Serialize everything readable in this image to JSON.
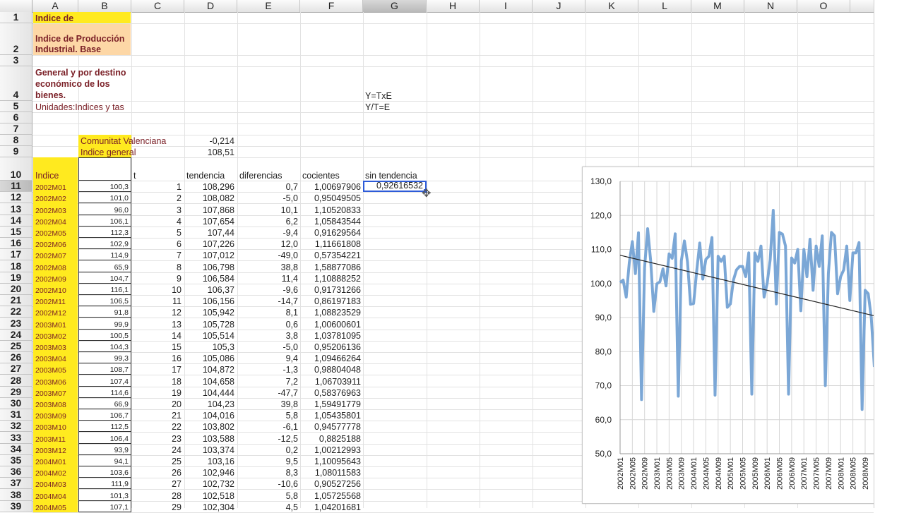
{
  "columns": [
    "A",
    "B",
    "C",
    "D",
    "E",
    "F",
    "G",
    "H",
    "I",
    "J",
    "K",
    "L",
    "M",
    "N",
    "O"
  ],
  "selected_column": "G",
  "selected_row": "11",
  "rows": [
    "1",
    "2",
    "3",
    "4",
    "5",
    "6",
    "7",
    "8",
    "9",
    "10",
    "11",
    "12",
    "13",
    "14",
    "15",
    "16",
    "17",
    "18",
    "19",
    "20",
    "21",
    "22",
    "23",
    "24",
    "25",
    "26",
    "27",
    "28",
    "29",
    "30",
    "31",
    "32",
    "33",
    "34",
    "35",
    "36",
    "37",
    "38",
    "39"
  ],
  "header_cells": {
    "a1": "Indice de",
    "a2": "Indice de Producción Industrial. Base",
    "a4": "General y por destino económico de los bienes.",
    "a5": "Unidades:Indices y tas",
    "b8": "Comunitat Valenciana",
    "d8": "-0,214",
    "b9": "Indice general",
    "d9": "108,51",
    "g4": "Y=TxE",
    "g5": "Y/T=E"
  },
  "table_headers": {
    "a": "Indice",
    "c": "t",
    "d": "tendencia",
    "e": "diferencias",
    "f": "cocientes",
    "g": "sin tendencia"
  },
  "data_rows": [
    {
      "a": "2002M01",
      "b": "100,3",
      "c": "1",
      "d": "108,296",
      "e": "0,7",
      "f": "1,00697906",
      "g": "0,92616532"
    },
    {
      "a": "2002M02",
      "b": "101,0",
      "c": "2",
      "d": "108,082",
      "e": "-5,0",
      "f": "0,95049505",
      "g": ""
    },
    {
      "a": "2002M03",
      "b": "96,0",
      "c": "3",
      "d": "107,868",
      "e": "10,1",
      "f": "1,10520833",
      "g": ""
    },
    {
      "a": "2002M04",
      "b": "106,1",
      "c": "4",
      "d": "107,654",
      "e": "6,2",
      "f": "1,05843544",
      "g": ""
    },
    {
      "a": "2002M05",
      "b": "112,3",
      "c": "5",
      "d": "107,44",
      "e": "-9,4",
      "f": "0,91629564",
      "g": ""
    },
    {
      "a": "2002M06",
      "b": "102,9",
      "c": "6",
      "d": "107,226",
      "e": "12,0",
      "f": "1,11661808",
      "g": ""
    },
    {
      "a": "2002M07",
      "b": "114,9",
      "c": "7",
      "d": "107,012",
      "e": "-49,0",
      "f": "0,57354221",
      "g": ""
    },
    {
      "a": "2002M08",
      "b": "65,9",
      "c": "8",
      "d": "106,798",
      "e": "38,8",
      "f": "1,58877086",
      "g": ""
    },
    {
      "a": "2002M09",
      "b": "104,7",
      "c": "9",
      "d": "106,584",
      "e": "11,4",
      "f": "1,10888252",
      "g": ""
    },
    {
      "a": "2002M10",
      "b": "116,1",
      "c": "10",
      "d": "106,37",
      "e": "-9,6",
      "f": "0,91731266",
      "g": ""
    },
    {
      "a": "2002M11",
      "b": "106,5",
      "c": "11",
      "d": "106,156",
      "e": "-14,7",
      "f": "0,86197183",
      "g": ""
    },
    {
      "a": "2002M12",
      "b": "91,8",
      "c": "12",
      "d": "105,942",
      "e": "8,1",
      "f": "1,08823529",
      "g": ""
    },
    {
      "a": "2003M01",
      "b": "99,9",
      "c": "13",
      "d": "105,728",
      "e": "0,6",
      "f": "1,00600601",
      "g": ""
    },
    {
      "a": "2003M02",
      "b": "100,5",
      "c": "14",
      "d": "105,514",
      "e": "3,8",
      "f": "1,03781095",
      "g": ""
    },
    {
      "a": "2003M03",
      "b": "104,3",
      "c": "15",
      "d": "105,3",
      "e": "-5,0",
      "f": "0,95206136",
      "g": ""
    },
    {
      "a": "2003M04",
      "b": "99,3",
      "c": "16",
      "d": "105,086",
      "e": "9,4",
      "f": "1,09466264",
      "g": ""
    },
    {
      "a": "2003M05",
      "b": "108,7",
      "c": "17",
      "d": "104,872",
      "e": "-1,3",
      "f": "0,98804048",
      "g": ""
    },
    {
      "a": "2003M06",
      "b": "107,4",
      "c": "18",
      "d": "104,658",
      "e": "7,2",
      "f": "1,06703911",
      "g": ""
    },
    {
      "a": "2003M07",
      "b": "114,6",
      "c": "19",
      "d": "104,444",
      "e": "-47,7",
      "f": "0,58376963",
      "g": ""
    },
    {
      "a": "2003M08",
      "b": "66,9",
      "c": "20",
      "d": "104,23",
      "e": "39,8",
      "f": "1,59491779",
      "g": ""
    },
    {
      "a": "2003M09",
      "b": "106,7",
      "c": "21",
      "d": "104,016",
      "e": "5,8",
      "f": "1,05435801",
      "g": ""
    },
    {
      "a": "2003M10",
      "b": "112,5",
      "c": "22",
      "d": "103,802",
      "e": "-6,1",
      "f": "0,94577778",
      "g": ""
    },
    {
      "a": "2003M11",
      "b": "106,4",
      "c": "23",
      "d": "103,588",
      "e": "-12,5",
      "f": "0,8825188",
      "g": ""
    },
    {
      "a": "2003M12",
      "b": "93,9",
      "c": "24",
      "d": "103,374",
      "e": "0,2",
      "f": "1,00212993",
      "g": ""
    },
    {
      "a": "2004M01",
      "b": "94,1",
      "c": "25",
      "d": "103,16",
      "e": "9,5",
      "f": "1,10095643",
      "g": ""
    },
    {
      "a": "2004M02",
      "b": "103,6",
      "c": "26",
      "d": "102,946",
      "e": "8,3",
      "f": "1,08011583",
      "g": ""
    },
    {
      "a": "2004M03",
      "b": "111,9",
      "c": "27",
      "d": "102,732",
      "e": "-10,6",
      "f": "0,90527256",
      "g": ""
    },
    {
      "a": "2004M04",
      "b": "101,3",
      "c": "28",
      "d": "102,518",
      "e": "5,8",
      "f": "1,05725568",
      "g": ""
    },
    {
      "a": "2004M05",
      "b": "107,1",
      "c": "29",
      "d": "102,304",
      "e": "4,5",
      "f": "1,04201681",
      "g": ""
    }
  ],
  "chart_data": {
    "type": "line",
    "ylim": [
      50,
      130
    ],
    "yticks": [
      "130,0",
      "120,0",
      "110,0",
      "100,0",
      "90,0",
      "80,0",
      "70,0",
      "60,0",
      "50,0"
    ],
    "xticks": [
      "2002M01",
      "2002M05",
      "2002M09",
      "2003M01",
      "2003M05",
      "2003M09",
      "2004M01",
      "2004M05",
      "2004M09",
      "2005M01",
      "2005M05",
      "2005M09",
      "2006M01",
      "2006M05",
      "2006M09",
      "2007M01",
      "2007M05",
      "2007M09",
      "2008M01",
      "2008M05",
      "2008M09"
    ],
    "grid": true,
    "series": [
      {
        "color": "#7ba7d6",
        "values": [
          100.3,
          101.0,
          96.0,
          106.1,
          112.3,
          102.9,
          114.9,
          65.9,
          104.7,
          116.1,
          106.5,
          91.8,
          99.9,
          100.5,
          104.3,
          99.3,
          108.7,
          107.4,
          114.6,
          66.9,
          106.7,
          112.5,
          106.4,
          93.9,
          94.1,
          103.6,
          111.9,
          101.3,
          107.1,
          108.0,
          113.5,
          67.2,
          108.0,
          106.5,
          108.0,
          93.0,
          94.0,
          101.0,
          104.0,
          105.0,
          105.0,
          102.0,
          109.0,
          67.5,
          109.0,
          106.5,
          111.0,
          96.0,
          100.0,
          107.0,
          121.5,
          94.0,
          115.0,
          114.5,
          111.0,
          67.5,
          107.5,
          106.0,
          110.0,
          92.0,
          110.0,
          102.0,
          113.0,
          98.0,
          111.0,
          105.0,
          114.0,
          70.0,
          103.0,
          115.0,
          114.0,
          97.0,
          102.0,
          104.0,
          111.0,
          95.0,
          109.0,
          109.0,
          112.0,
          63.0,
          98.0,
          97.0,
          90.0,
          75.5
        ]
      },
      {
        "color": "#222222",
        "values": [
          108.296,
          90.5
        ]
      }
    ]
  }
}
